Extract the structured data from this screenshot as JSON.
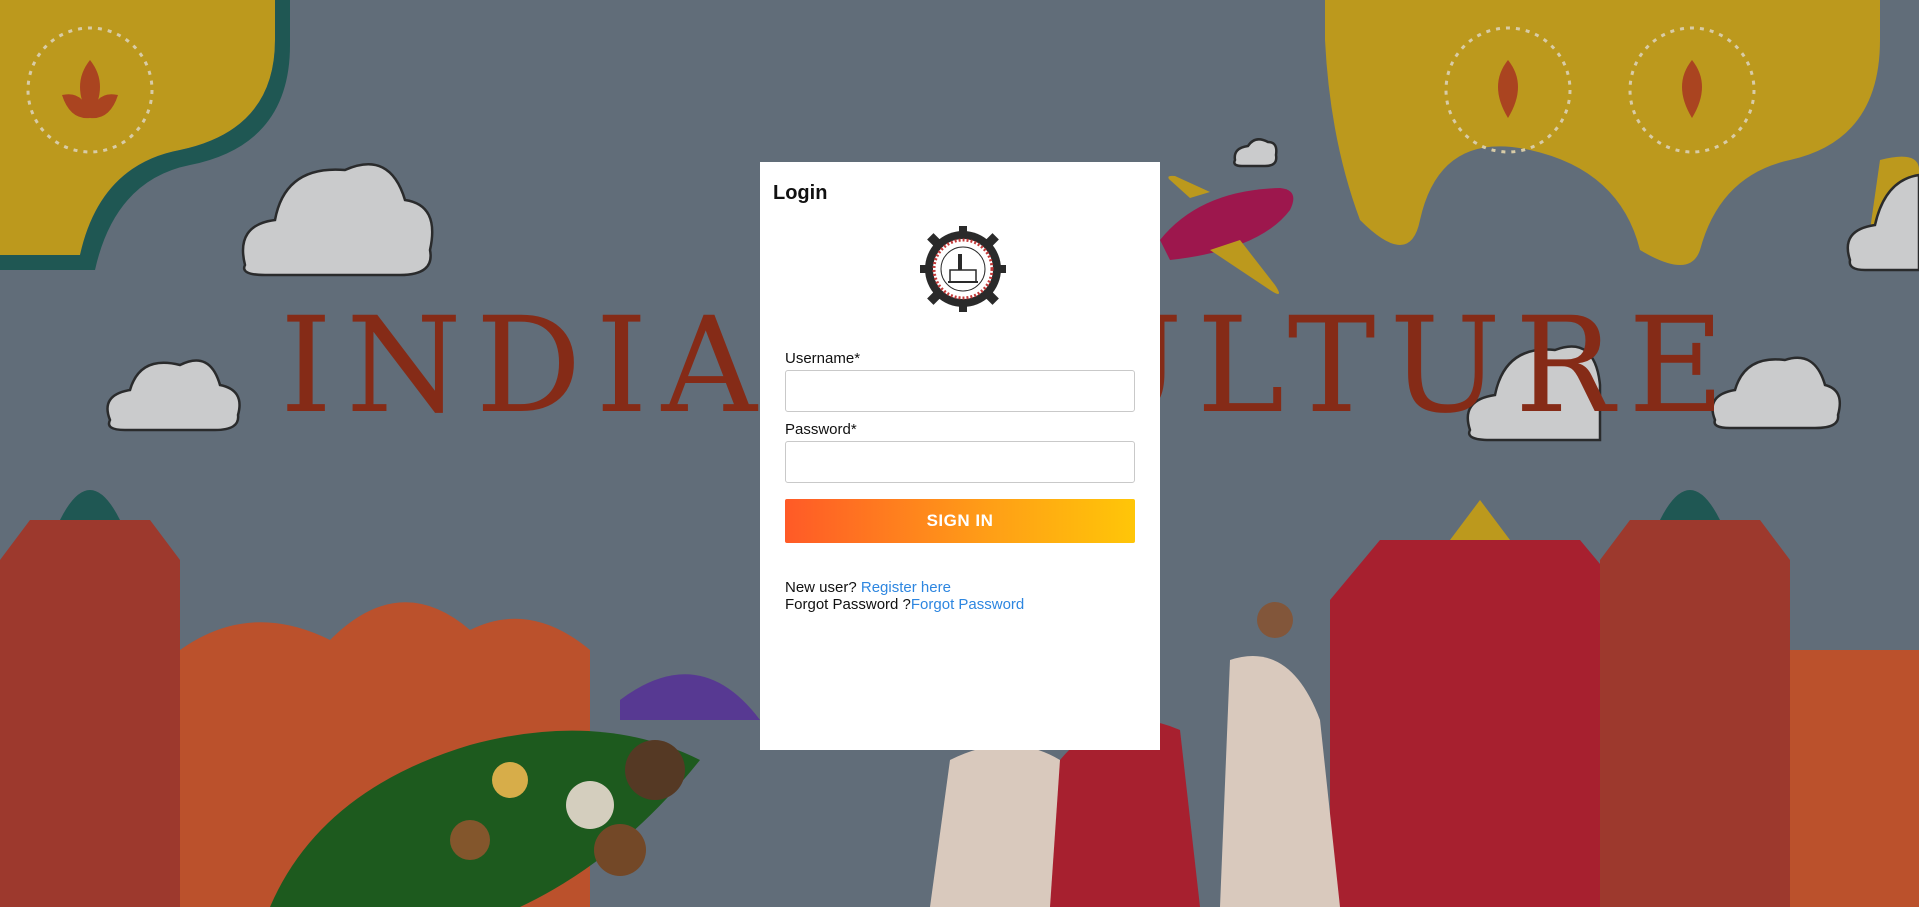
{
  "background": {
    "banner_text": "INDIAN CULTURE",
    "colors": {
      "sky": "#66727e",
      "accent_red": "#8e2b14",
      "mustard": "#c9a21b",
      "teal": "#1f5b55"
    }
  },
  "login": {
    "title": "Login",
    "logo_icon": "institution-gear-logo-icon",
    "username_label": "Username*",
    "username_value": "",
    "password_label": "Password*",
    "password_value": "",
    "sign_in_label": "SIGN IN",
    "new_user_text": "New user? ",
    "register_link": "Register here",
    "forgot_text": "Forgot Password ?",
    "forgot_link": "Forgot Password",
    "colors": {
      "link": "#2d86e0",
      "button_start": "#ff5a27",
      "button_end": "#ffc608"
    }
  }
}
